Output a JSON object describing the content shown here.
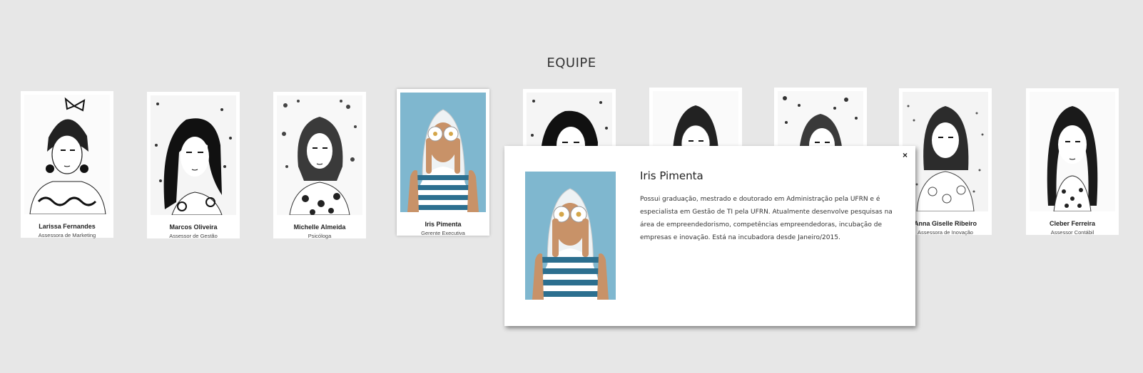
{
  "section": {
    "title": "EQUIPE"
  },
  "team": [
    {
      "name": "Larissa Fernandes",
      "role": "Assessora de Marketing"
    },
    {
      "name": "Marcos Oliveira",
      "role": "Assessor de Gestão"
    },
    {
      "name": "Michelle Almeida",
      "role": "Psicóloga"
    },
    {
      "name": "Iris Pimenta",
      "role": "Gerente Executiva"
    },
    {
      "name": "",
      "role": ""
    },
    {
      "name": "",
      "role": ""
    },
    {
      "name": "",
      "role": ""
    },
    {
      "name": "Anna Giselle Ribeiro",
      "role": "Assessora de Inovação"
    },
    {
      "name": "Cleber Ferreira",
      "role": "Assessor Contábil"
    }
  ],
  "modal": {
    "name": "Iris Pimenta",
    "bio": "Possui graduação, mestrado e doutorado em Administração pela UFRN e é especialista em Gestão de TI pela UFRN. Atualmente desenvolve pesquisas na área de empreendedorismo, competências empreendedoras, incubação de empresas e inovação. Está na incubadora desde Janeiro/2015.",
    "close_label": "×"
  },
  "colors": {
    "background": "#e7e7e7",
    "accent_photo_bg": "#7fb7cf"
  }
}
